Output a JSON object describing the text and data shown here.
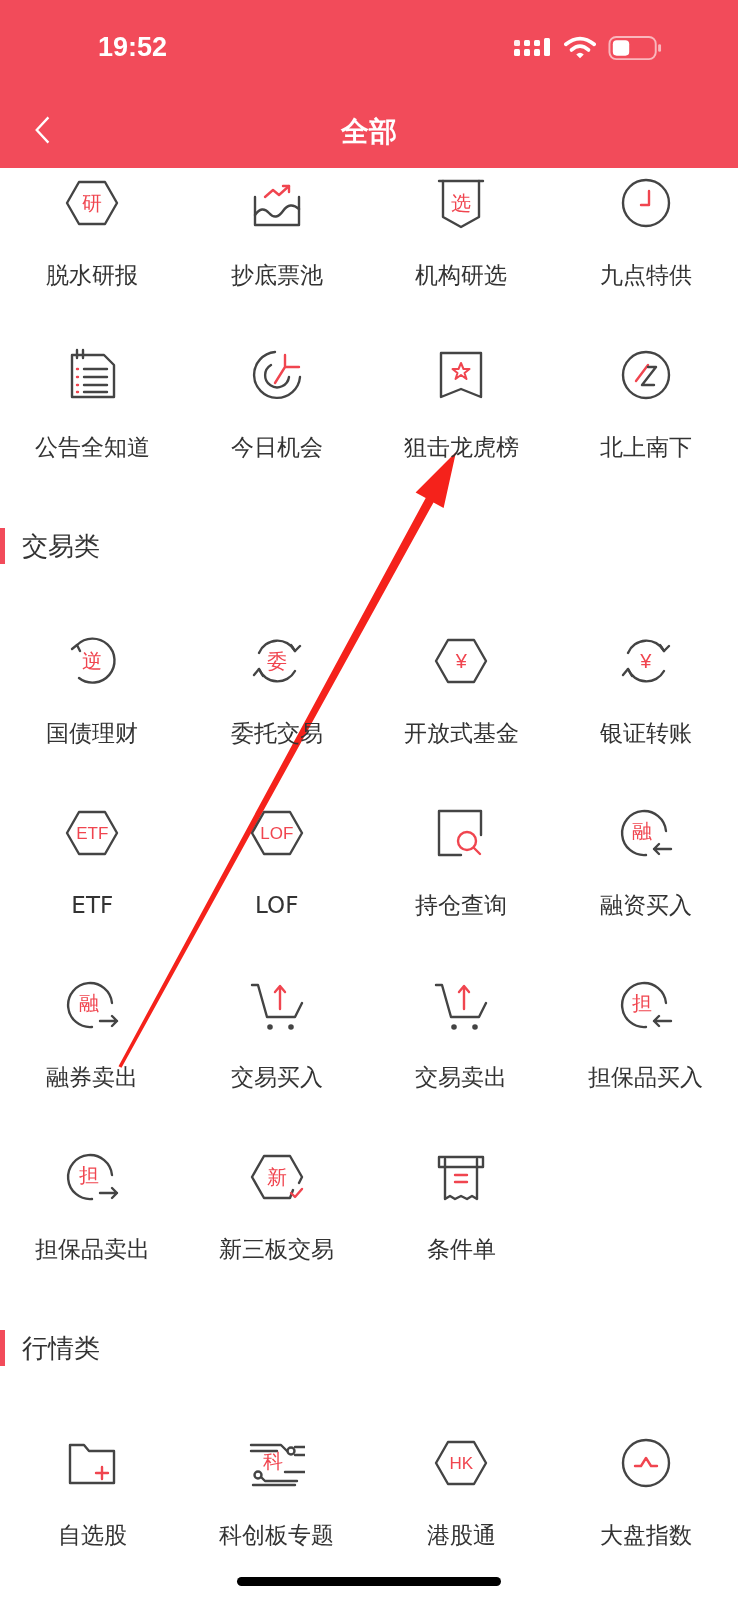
{
  "status_bar": {
    "time": "19:52"
  },
  "nav": {
    "title": "全部"
  },
  "sections": [
    {
      "items": [
        {
          "label": "脱水研报",
          "kind": "hexagon",
          "glyph": "研"
        },
        {
          "label": "抄底票池",
          "kind": "wave-chart"
        },
        {
          "label": "机构研选",
          "kind": "shield",
          "glyph": "选"
        },
        {
          "label": "九点特供",
          "kind": "clock"
        },
        {
          "label": "公告全知道",
          "kind": "notes"
        },
        {
          "label": "今日机会",
          "kind": "target"
        },
        {
          "label": "狙击龙虎榜",
          "kind": "bookmark-star"
        },
        {
          "label": "北上南下",
          "kind": "circle-slash"
        }
      ]
    },
    {
      "title": "交易类",
      "items": [
        {
          "label": "国债理财",
          "kind": "cycle-left",
          "glyph": "逆"
        },
        {
          "label": "委托交易",
          "kind": "cycle-both",
          "glyph": "委"
        },
        {
          "label": "开放式基金",
          "kind": "hexagon",
          "glyph": "¥"
        },
        {
          "label": "银证转账",
          "kind": "cycle-both",
          "glyph": "¥"
        },
        {
          "label": "ETF",
          "kind": "hexagon",
          "glyph": "ETF"
        },
        {
          "label": "LOF",
          "kind": "hexagon",
          "glyph": "LOF"
        },
        {
          "label": "持仓查询",
          "kind": "search-doc"
        },
        {
          "label": "融资买入",
          "kind": "arrow-in",
          "glyph": "融"
        },
        {
          "label": "融券卖出",
          "kind": "arrow-out",
          "glyph": "融"
        },
        {
          "label": "交易买入",
          "kind": "cart"
        },
        {
          "label": "交易卖出",
          "kind": "cart"
        },
        {
          "label": "担保品买入",
          "kind": "arrow-in",
          "glyph": "担"
        },
        {
          "label": "担保品卖出",
          "kind": "arrow-out",
          "glyph": "担"
        },
        {
          "label": "新三板交易",
          "kind": "hex-check",
          "glyph": "新"
        },
        {
          "label": "条件单",
          "kind": "receipt"
        }
      ]
    },
    {
      "title": "行情类",
      "items": [
        {
          "label": "自选股",
          "kind": "folder-plus"
        },
        {
          "label": "科创板专题",
          "kind": "circuit",
          "glyph": "科"
        },
        {
          "label": "港股通",
          "kind": "hexagon",
          "glyph": "HK"
        },
        {
          "label": "大盘指数",
          "kind": "pulse"
        }
      ]
    }
  ]
}
